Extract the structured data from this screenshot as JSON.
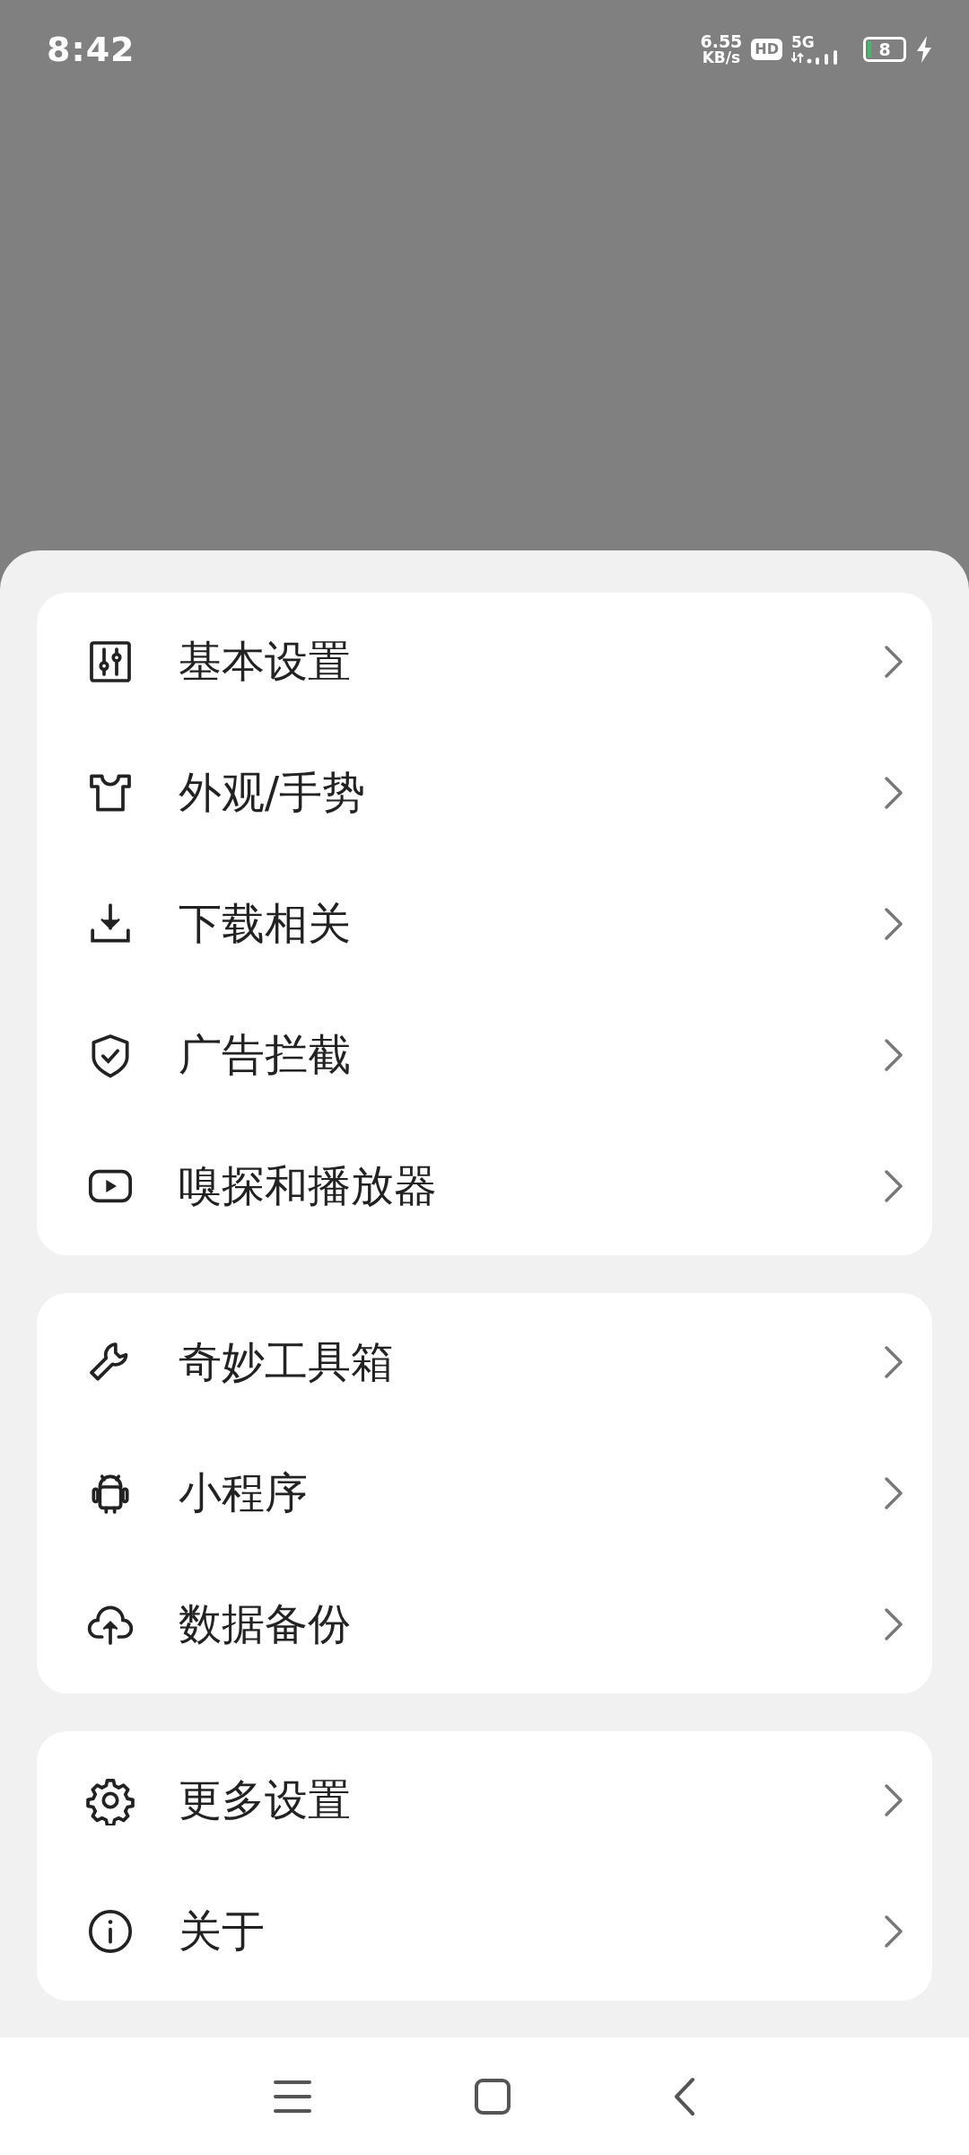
{
  "status_bar": {
    "time": "8:42",
    "net_speed_value": "6.55",
    "net_speed_unit": "KB/s",
    "hd_badge": "HD",
    "network_type": "5G",
    "battery_level": "8"
  },
  "menu_groups": [
    {
      "items": [
        {
          "label": "基本设置"
        },
        {
          "label": "外观/手势"
        },
        {
          "label": "下载相关"
        },
        {
          "label": "广告拦截"
        },
        {
          "label": "嗅探和播放器"
        }
      ]
    },
    {
      "items": [
        {
          "label": "奇妙工具箱"
        },
        {
          "label": "小程序"
        },
        {
          "label": "数据备份"
        }
      ]
    },
    {
      "items": [
        {
          "label": "更多设置"
        },
        {
          "label": "关于"
        }
      ]
    }
  ]
}
